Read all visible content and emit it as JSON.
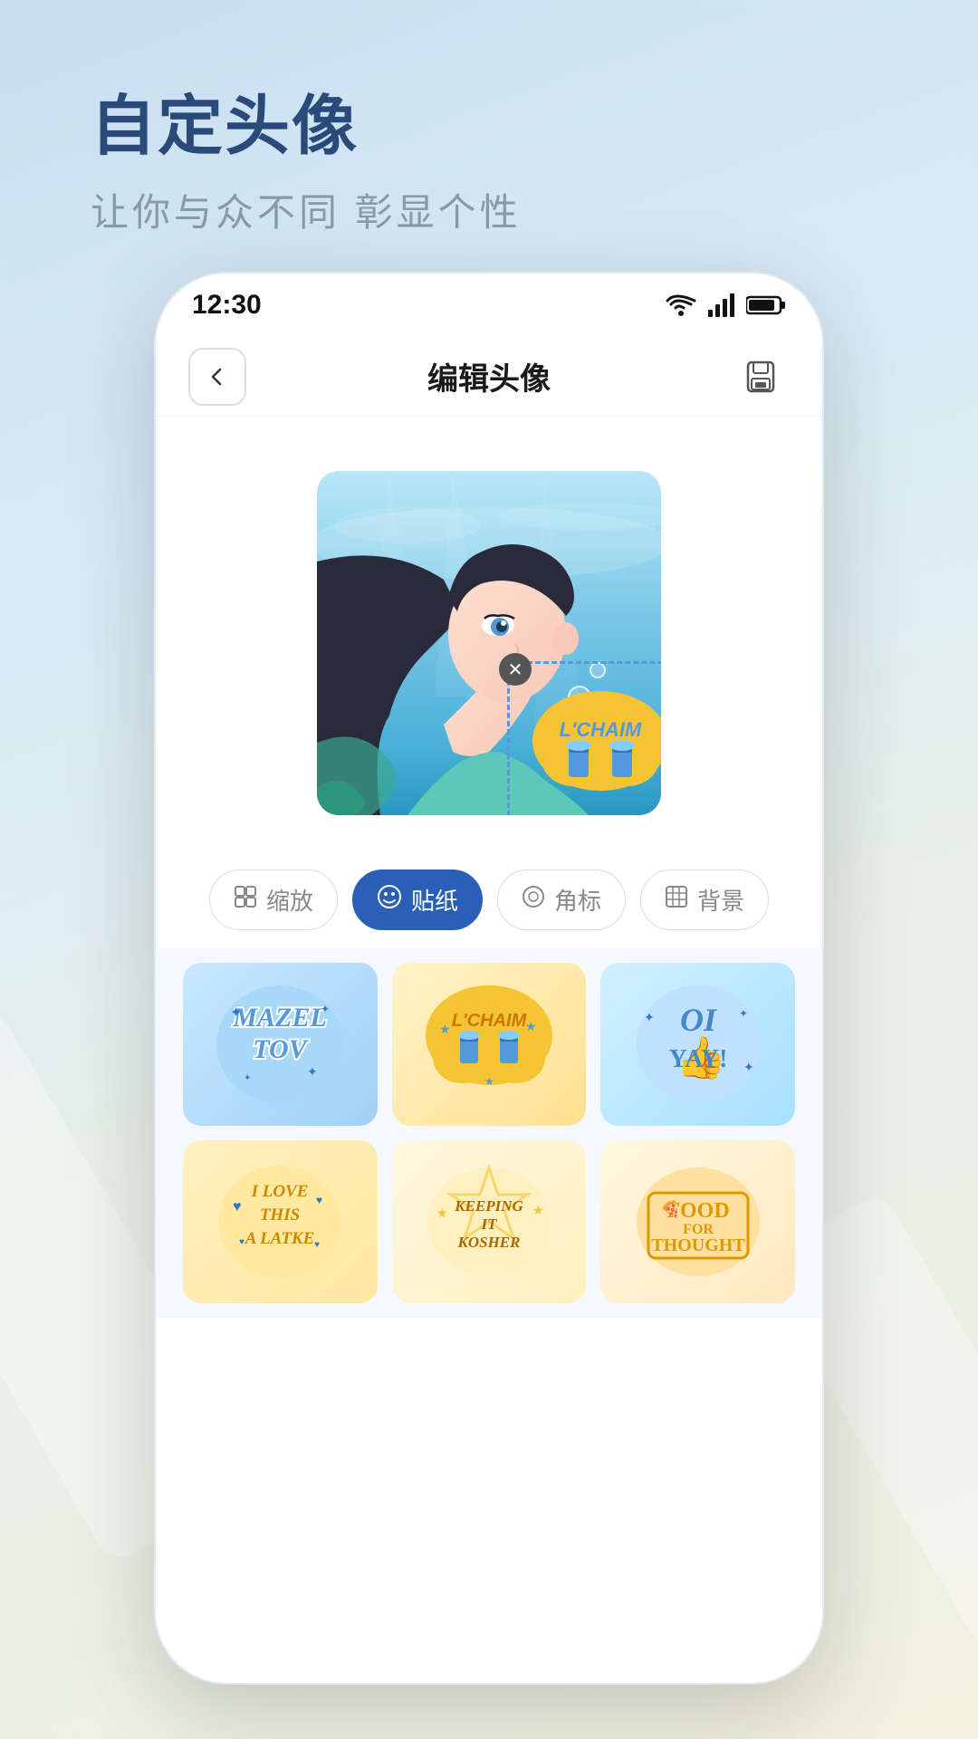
{
  "background": {
    "gradient_start": "#c8dff0",
    "gradient_end": "#f0f0e0"
  },
  "header": {
    "title": "自定头像",
    "subtitle": "让你与众不同 彰显个性"
  },
  "status_bar": {
    "time": "12:30",
    "wifi": "wifi",
    "signal": "signal",
    "battery": "battery"
  },
  "nav": {
    "title": "编辑头像",
    "back_label": "‹",
    "save_label": "save"
  },
  "toolbar": {
    "tabs": [
      {
        "id": "zoom",
        "icon": "⊞",
        "label": "缩放",
        "active": false
      },
      {
        "id": "sticker",
        "icon": "🙂",
        "label": "贴纸",
        "active": true
      },
      {
        "id": "badge",
        "icon": "◎",
        "label": "角标",
        "active": false
      },
      {
        "id": "bg",
        "icon": "▦",
        "label": "背景",
        "active": false
      }
    ]
  },
  "stickers": [
    {
      "id": "mazel",
      "text": "MAZEL\nTOV",
      "type": "mazel",
      "stars": true
    },
    {
      "id": "lchaim",
      "text": "L'CHAIM",
      "type": "lchaim"
    },
    {
      "id": "oi",
      "text": "OI\nYAY!",
      "type": "oi"
    },
    {
      "id": "latke",
      "text": "I LOVE\nTHIS\nA LATKE",
      "type": "latke"
    },
    {
      "id": "kosher",
      "text": "KEEPING IT\nKOSHER",
      "type": "kosher"
    },
    {
      "id": "food",
      "text": "FOOD\nFOR\nTHOUGHT",
      "type": "food"
    }
  ]
}
